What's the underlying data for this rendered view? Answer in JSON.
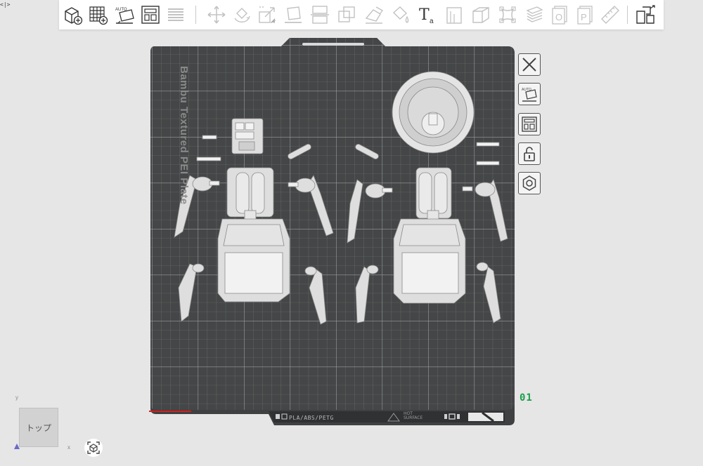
{
  "corner_toggle": "<|>",
  "toolbar": {
    "items": [
      {
        "name": "add-object",
        "icon": "cube-plus-icon",
        "enabled": true
      },
      {
        "name": "add-plate",
        "icon": "grid-plus-icon",
        "enabled": true
      },
      {
        "name": "auto-orient",
        "icon": "auto-orient-icon",
        "label": "AUTO",
        "enabled": true
      },
      {
        "name": "arrange",
        "icon": "arrange-icon",
        "enabled": true
      },
      {
        "name": "split-layers",
        "icon": "layers-icon",
        "enabled": false
      },
      {
        "name": "move",
        "icon": "move-arrows-icon",
        "enabled": false
      },
      {
        "name": "rotate",
        "icon": "rotate-icon",
        "enabled": false
      },
      {
        "name": "scale",
        "icon": "scale-icon",
        "enabled": false
      },
      {
        "name": "lay-on-face",
        "icon": "lay-on-face-icon",
        "enabled": false
      },
      {
        "name": "cut",
        "icon": "cut-icon",
        "enabled": false
      },
      {
        "name": "boolean",
        "icon": "boolean-icon",
        "enabled": false
      },
      {
        "name": "support-paint",
        "icon": "support-paint-icon",
        "enabled": false
      },
      {
        "name": "color-paint",
        "icon": "paint-bucket-icon",
        "enabled": false
      },
      {
        "name": "text",
        "icon": "text-icon",
        "label": "T",
        "sublabel": "a",
        "enabled": true
      },
      {
        "name": "seam",
        "icon": "seam-icon",
        "enabled": false
      },
      {
        "name": "assembly",
        "icon": "box-icon",
        "enabled": false
      },
      {
        "name": "measure",
        "icon": "measure-icon",
        "enabled": false
      },
      {
        "name": "variable-layer",
        "icon": "variable-layer-icon",
        "enabled": false
      },
      {
        "name": "object-list",
        "icon": "object-o-icon",
        "label": "O",
        "enabled": false
      },
      {
        "name": "part-list",
        "icon": "part-p-icon",
        "label": "P",
        "enabled": false
      },
      {
        "name": "ruler",
        "icon": "ruler-icon",
        "enabled": false
      },
      {
        "name": "explode",
        "icon": "explode-icon",
        "enabled": true
      }
    ]
  },
  "plate": {
    "name": "Bambu Textured PEI Plate",
    "number": "01",
    "filament_types": "PLA/ABS/PETG",
    "surface_note_line1": "HOT",
    "surface_note_line2": "SURFACE",
    "accent_green": "#1aa04a",
    "plate_color": "#3e4041",
    "grid_color": "#8c8e8f",
    "model_color": "#dedede"
  },
  "side_buttons": [
    {
      "name": "close-plate",
      "icon": "close-icon"
    },
    {
      "name": "auto-orient-plate",
      "icon": "auto-orient-icon",
      "label": "AUTO"
    },
    {
      "name": "arrange-plate",
      "icon": "arrange-icon"
    },
    {
      "name": "lock-plate",
      "icon": "lock-icon"
    },
    {
      "name": "plate-settings",
      "icon": "gear-icon"
    }
  ],
  "view_cube": {
    "face_label": "トップ",
    "axis_x": "x",
    "axis_y": "y"
  }
}
